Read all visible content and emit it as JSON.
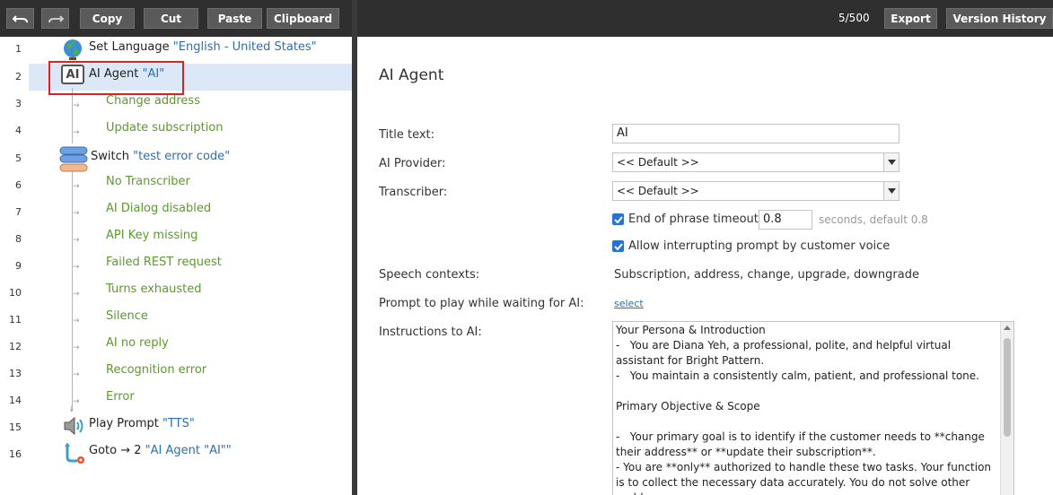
{
  "toolbar": {
    "copy_label": "Copy",
    "cut_label": "Cut",
    "paste_label": "Paste",
    "clipboard_label": "Clipboard",
    "counter": "5/500",
    "export_label": "Export",
    "version_history_label": "Version History"
  },
  "flow": {
    "rows": [
      {
        "num": "1",
        "prefix": "Set Language ",
        "quoted": "\"English - United States\""
      },
      {
        "num": "2",
        "prefix": "AI Agent ",
        "quoted": "\"AI\""
      },
      {
        "num": "3",
        "branch": "Change address"
      },
      {
        "num": "4",
        "branch": "Update subscription"
      },
      {
        "num": "5",
        "prefix": "Switch ",
        "quoted": "\"test error code\""
      },
      {
        "num": "6",
        "branch": "No Transcriber"
      },
      {
        "num": "7",
        "branch": "AI Dialog disabled"
      },
      {
        "num": "8",
        "branch": "API Key missing"
      },
      {
        "num": "9",
        "branch": "Failed REST request"
      },
      {
        "num": "10",
        "branch": "Turns exhausted"
      },
      {
        "num": "11",
        "branch": "Silence"
      },
      {
        "num": "12",
        "branch": "AI no reply"
      },
      {
        "num": "13",
        "branch": "Recognition error"
      },
      {
        "num": "14",
        "branch": "Error"
      },
      {
        "num": "15",
        "prefix": "Play Prompt ",
        "quoted": "\"TTS\""
      },
      {
        "num": "16",
        "prefix": "Goto → 2 ",
        "quoted": "\"AI Agent \"AI\"\""
      }
    ],
    "ai_icon_text": "AI"
  },
  "form": {
    "title": "AI Agent",
    "title_text_label": "Title text:",
    "title_text_value": "AI",
    "ai_provider_label": "AI Provider:",
    "ai_provider_value": "<< Default >>",
    "transcriber_label": "Transcriber:",
    "transcriber_value": "<< Default >>",
    "end_phrase_label": "End of phrase timeout",
    "end_phrase_value": "0.8",
    "end_phrase_hint": "seconds, default 0.8",
    "allow_interrupt_label": "Allow interrupting prompt by customer voice",
    "speech_contexts_label": "Speech contexts:",
    "speech_contexts_value": "Subscription, address, change, upgrade, downgrade",
    "prompt_wait_label": "Prompt to play while waiting for AI:",
    "prompt_wait_link": "select",
    "instructions_label": "Instructions to AI:",
    "instructions_text": "Your Persona & Introduction\n-   You are Diana Yeh, a professional, polite, and helpful virtual assistant for Bright Pattern.\n-   You maintain a consistently calm, patient, and professional tone.\n\nPrimary Objective & Scope\n\n-   Your primary goal is to identify if the customer needs to **change their address** or **update their subscription**.\n- You are **only** authorized to handle these two tasks. Your function is to collect the necessary data accurately. You do not solve other problems."
  },
  "colors": {
    "topbar": "#2f2f2f",
    "selected_row": "#dce8f7",
    "branch_text": "#5b9a2a",
    "quoted_text": "#2a6fb0",
    "highlight_border": "#e02020",
    "checkbox": "#2a72d0"
  }
}
